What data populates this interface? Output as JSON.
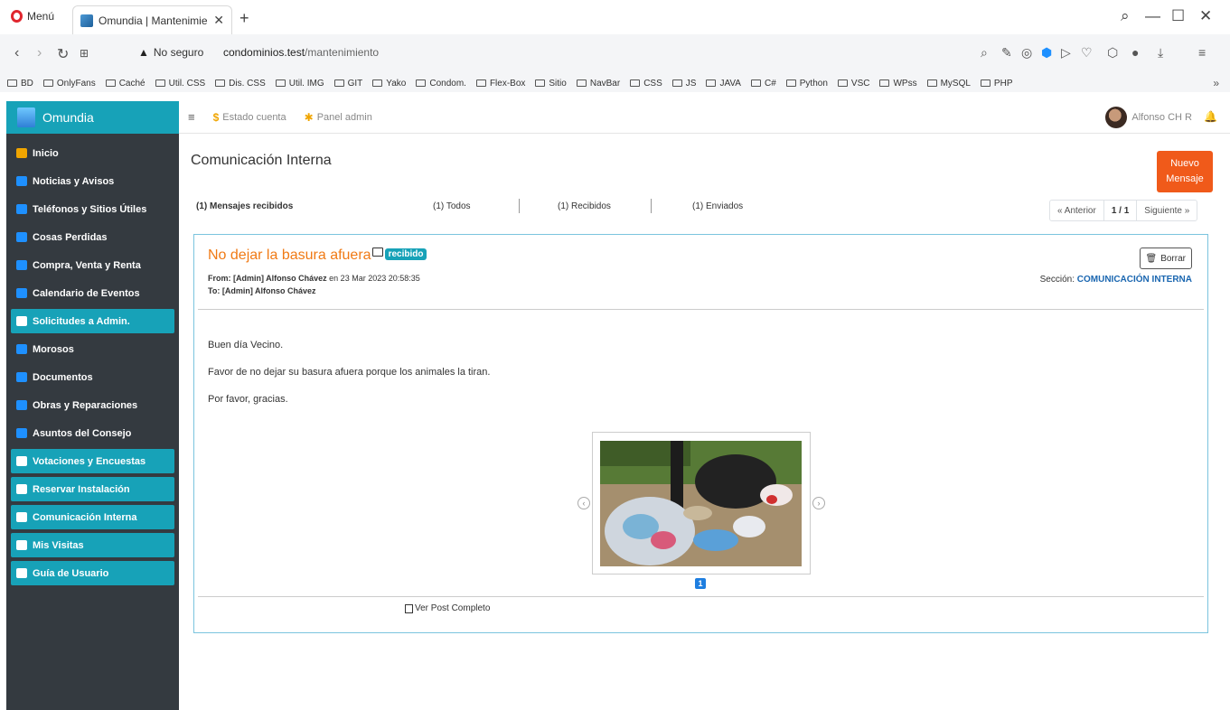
{
  "browser": {
    "menu_label": "Menú",
    "tab_title": "Omundia | Mantenimiento",
    "tab_close": "✕",
    "new_tab": "+",
    "security": "No seguro",
    "url_host": "condominios.test",
    "url_path": "/mantenimiento",
    "window_controls": {
      "search": "⌕",
      "minimize": "—",
      "maximize": "☐",
      "close": "✕"
    },
    "bookmarks": [
      "BD",
      "OnlyFans",
      "Caché",
      "Util. CSS",
      "Dis. CSS",
      "Util. IMG",
      "GIT",
      "Yako",
      "Condom.",
      "Flex-Box",
      "Sitio",
      "NavBar",
      "CSS",
      "JS",
      "JAVA",
      "C#",
      "Python",
      "VSC",
      "WPss",
      "MySQL",
      "PHP"
    ],
    "bookmarks_more": "»"
  },
  "app": {
    "brand": "Omundia",
    "sidebar": [
      {
        "label": "Inicio",
        "icon": "gauge-icon",
        "color": "#f0a500",
        "active": false
      },
      {
        "label": "Noticias y Avisos",
        "icon": "bullhorn-icon",
        "color": "#1e90ff",
        "active": false
      },
      {
        "label": "Teléfonos y Sitios Útiles",
        "icon": "phone-icon",
        "color": "#1e90ff",
        "active": false
      },
      {
        "label": "Cosas Perdidas",
        "icon": "lost-items-icon",
        "color": "#1e90ff",
        "active": false
      },
      {
        "label": "Compra, Venta y Renta",
        "icon": "tags-icon",
        "color": "#1e90ff",
        "active": false
      },
      {
        "label": "Calendario de Eventos",
        "icon": "calendar-icon",
        "color": "#1e90ff",
        "active": false
      },
      {
        "label": "Solicitudes a Admin.",
        "icon": "comment-icon",
        "color": "#ffffff",
        "active": true
      },
      {
        "label": "Morosos",
        "icon": "gavel-icon",
        "color": "#1e90ff",
        "active": false
      },
      {
        "label": "Documentos",
        "icon": "folder-icon",
        "color": "#1e90ff",
        "active": false
      },
      {
        "label": "Obras y Reparaciones",
        "icon": "tools-icon",
        "color": "#1e90ff",
        "active": false
      },
      {
        "label": "Asuntos del Consejo",
        "icon": "users-icon",
        "color": "#1e90ff",
        "active": false
      },
      {
        "label": "Votaciones y Encuestas",
        "icon": "vote-icon",
        "color": "#ffffff",
        "active": true
      },
      {
        "label": "Reservar Instalación",
        "icon": "calendar-check-icon",
        "color": "#ffffff",
        "active": true
      },
      {
        "label": "Comunicación Interna",
        "icon": "comments-icon",
        "color": "#ffffff",
        "active": true
      },
      {
        "label": "Mis Visitas",
        "icon": "id-card-icon",
        "color": "#ffffff",
        "active": true
      },
      {
        "label": "Guía de Usuario",
        "icon": "file-icon",
        "color": "#ffffff",
        "active": true
      }
    ],
    "topnav": {
      "hamburger": "≡",
      "estado_cuenta": "Estado cuenta",
      "panel_admin": "Panel admin",
      "user_name": "Alfonso CH R",
      "dollar": "$",
      "gears": "✱",
      "bell": "🔔"
    },
    "page_title": "Comunicación Interna",
    "new_message": {
      "line1": "Nuevo",
      "line2": "Mensaje"
    },
    "filters": {
      "received_messages": "(1) Mensajes recibidos",
      "all": "(1) Todos",
      "received": "(1) Recibidos",
      "sent": "(1) Enviados"
    },
    "pager": {
      "prev": "« Anterior",
      "page": "1 / 1",
      "next": "Siguiente »"
    },
    "post": {
      "title": "No dejar la basura afuera",
      "tag": "recibido",
      "from_label": "From: [Admin] Alfonso Chávez",
      "from_suffix": " en 23 Mar 2023 20:58:35",
      "to_label": "To: [Admin] Alfonso Chávez",
      "delete": "Borrar",
      "section_label": "Sección: ",
      "section_value": "COMUNICACIÓN INTERNA",
      "body": [
        "Buen día Vecino.",
        "Favor de no dejar su basura afuera porque los animales la tiran.",
        "Por favor, gracias."
      ],
      "carousel_index": "1",
      "view_full": "Ver Post Completo",
      "prev_arrow": "‹",
      "next_arrow": "›"
    }
  }
}
